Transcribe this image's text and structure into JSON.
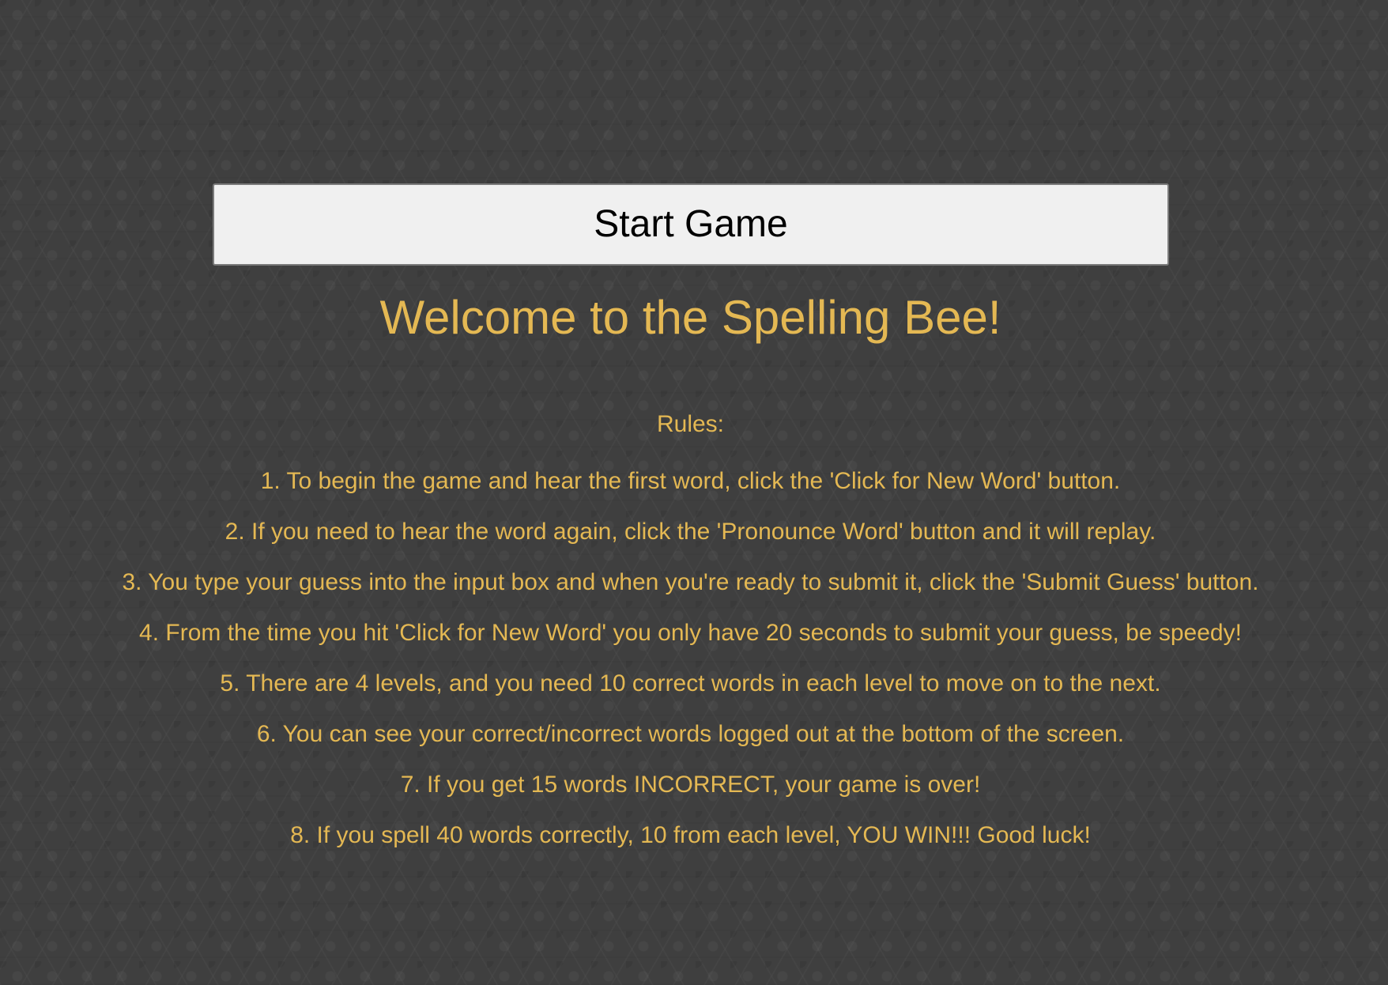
{
  "start_button": {
    "label": "Start Game"
  },
  "welcome": {
    "title": "Welcome to the Spelling Bee!"
  },
  "rules": {
    "heading": "Rules:",
    "items": [
      "1. To begin the game and hear the first word, click the 'Click for New Word' button.",
      "2. If you need to hear the word again, click the 'Pronounce Word' button and it will replay.",
      "3. You type your guess into the input box and when you're ready to submit it, click the 'Submit Guess' button.",
      "4. From the time you hit 'Click for New Word' you only have 20 seconds to submit your guess, be speedy!",
      "5. There are 4 levels, and you need 10 correct words in each level to move on to the next.",
      "6. You can see your correct/incorrect words logged out at the bottom of the screen.",
      "7. If you get 15 words INCORRECT, your game is over!",
      "8. If you spell 40 words correctly, 10 from each level, YOU WIN!!! Good luck!"
    ]
  },
  "theme": {
    "background": "#3f3f3f",
    "accent_text": "#e4b853",
    "button_bg": "#f0f0f0",
    "button_text": "#000000"
  }
}
